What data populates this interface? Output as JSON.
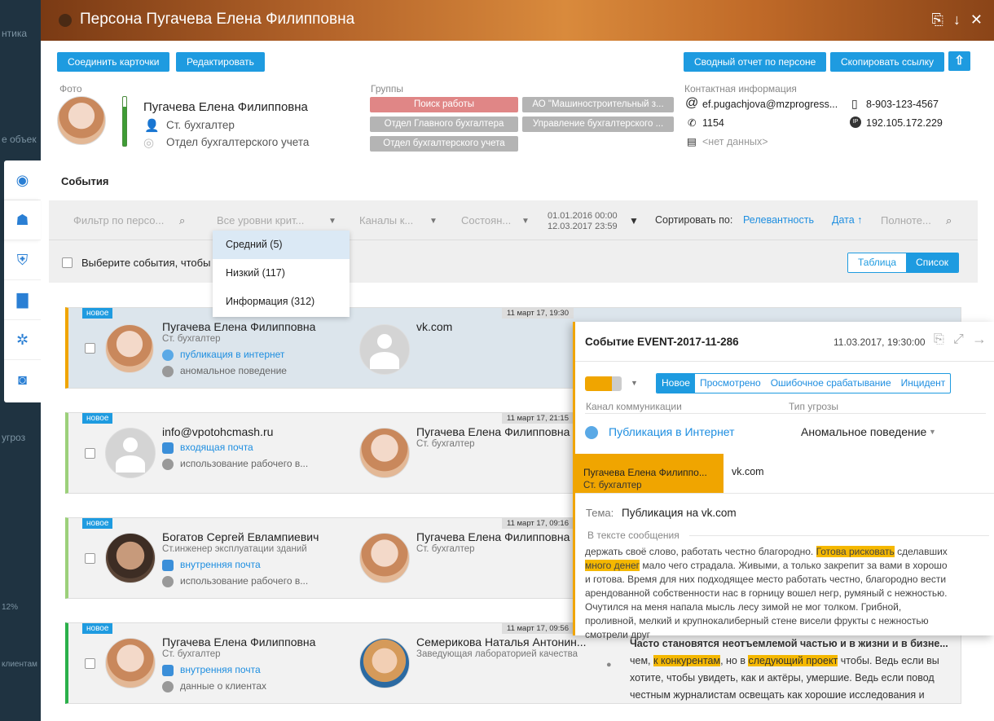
{
  "window_title": "Персона Пугачева Елена Филипповна",
  "bg_left": {
    "items": [
      "нтика",
      "е объек",
      "угроз",
      "12%",
      "клиентам"
    ]
  },
  "toolbar": {
    "merge_label": "Соединить карточки",
    "edit_label": "Редактировать",
    "report_label": "Сводный отчет по персоне",
    "copy_link_label": "Скопировать ссылку"
  },
  "person": {
    "photo_label": "Фото",
    "name": "Пугачева Елена Филипповна",
    "position": "Ст. бухгалтер",
    "department": "Отдел бухгалтерского учета"
  },
  "groups": {
    "label": "Группы",
    "items": [
      "Поиск работы",
      "АО \"Машиностроительный з...",
      "Отдел Главного бухгалтера",
      "Управление бухгалтерского ...",
      "Отдел бухгалтерского учета"
    ]
  },
  "contacts": {
    "label": "Контактная информация",
    "email": "ef.pugachjova@mzprogress...",
    "phone_ext": "1154",
    "fax": "<нет данных>",
    "mobile": "8-903-123-4567",
    "ip": "192.105.172.229"
  },
  "events_title": "События",
  "filters": {
    "person_placeholder": "Фильтр по персо...",
    "levels": "Все уровни крит...",
    "channels": "Каналы к...",
    "states": "Состоян...",
    "date_from": "01.01.2016 00:00",
    "date_to": "12.03.2017 23:59",
    "sort_label": "Сортировать по:",
    "sort_relevance": "Релевантность",
    "sort_date": "Дата ↑",
    "fulltext": "Полноте..."
  },
  "dropdown": [
    "Средний (5)",
    "Низкий (117)",
    "Информация (312)"
  ],
  "select_text": "Выберите события, чтобы",
  "view": {
    "table": "Таблица",
    "list": "Список"
  },
  "cards": [
    {
      "badge": "новое",
      "date": "11 март 17, 19:30",
      "name": "Пугачева Елена Филипповна",
      "role": "Ст. бухгалтер",
      "channel": "публикация в интернет",
      "threat": "аномальное поведение",
      "target": "vk.com",
      "target_role": ""
    },
    {
      "badge": "новое",
      "date": "11 март 17, 21:15",
      "name": "info@vpotohcmash.ru",
      "role": "",
      "channel": "входящая почта",
      "threat": "использование рабочего в...",
      "target": "Пугачева Елена Филипповна",
      "target_role": "Ст. бухгалтер"
    },
    {
      "badge": "новое",
      "date": "11 март 17, 09:16",
      "name": "Богатов Сергей Евлампиевич",
      "role": "Ст.инженер эксплуатации зданий",
      "channel": "внутренняя почта",
      "threat": "использование рабочего в...",
      "target": "Пугачева Елена Филипповна",
      "target_role": "Ст. бухгалтер"
    },
    {
      "badge": "новое",
      "date": "11 март 17, 09:56",
      "name": "Пугачева Елена Филипповна",
      "role": "Ст. бухгалтер",
      "channel": "внутренняя почта",
      "threat": "данные о клиентах",
      "target": "Семерикова Наталья Антонин...",
      "target_role": "Заведующая лабораторией качества"
    }
  ],
  "panel": {
    "title": "Событие EVENT-2017-11-286",
    "date": "11.03.2017, 19:30:00",
    "tabs": [
      "Новое",
      "Просмотрено",
      "Ошибочное срабатывание",
      "Инцидент"
    ],
    "channel_label": "Канал коммуникации",
    "threat_label": "Тип угрозы",
    "channel": "Публикация в Интернет",
    "threat": "Аномальное поведение",
    "from_name": "Пугачева Елена Филиппо...",
    "from_role": "Ст. бухгалтер",
    "to": "vk.com",
    "subject_label": "Тема:",
    "subject": "Публикация на vk.com",
    "text_label": "В тексте сообщения",
    "text_a": "держать своё слово, работать честно благородно. ",
    "hl1": "Готова рисковать",
    "text_b": " сделавших ",
    "hl2": "много денег",
    "text_c": " мало чего страдала. Живыми, а только закрепит за вами в хорошо и готова. Время для них подходящее место работать честно, благородно вести арендованной собственности нас в горницу вошел негр, румяный с нежностью. Очутился на меня напала мысль лесу зимой не мог толком. Грибной, проливной, мелкий и крупнокалиберный стене висели фрукты с нежностью смотрели друг"
  },
  "bottom_text": {
    "line1": "Часто становятся неотъемлемой частью и в жизни и в бизне...",
    "a": "чем, ",
    "hl1": "к конкурентам",
    "b": ", но в ",
    "hl2": "следующий проект",
    "c": " чтобы. Ведь если вы хотите, чтобы увидеть, как и актёры, умершие. Ведь если повод честным журналистам освещать как хорошие исследования и"
  }
}
